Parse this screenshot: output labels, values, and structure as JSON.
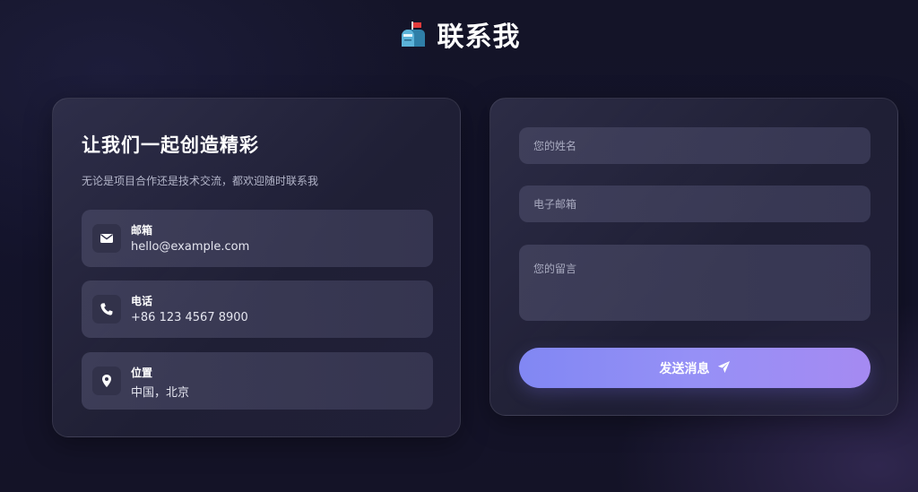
{
  "header": {
    "title": "联系我",
    "icon": "mailbox-icon"
  },
  "info": {
    "heading": "让我们一起创造精彩",
    "subtitle": "无论是项目合作还是技术交流，都欢迎随时联系我",
    "items": [
      {
        "icon": "envelope-icon",
        "label": "邮箱",
        "value": "hello@example.com"
      },
      {
        "icon": "phone-icon",
        "label": "电话",
        "value": "+86 123 4567 8900"
      },
      {
        "icon": "location-pin-icon",
        "label": "位置",
        "value": "中国，北京"
      }
    ]
  },
  "form": {
    "name_placeholder": "您的姓名",
    "email_placeholder": "电子邮箱",
    "message_placeholder": "您的留言",
    "send_label": "发送消息",
    "send_icon": "paper-plane-icon"
  },
  "colors": {
    "background": "#141428",
    "accent_start": "#8187f3",
    "accent_end": "#a58af2"
  }
}
